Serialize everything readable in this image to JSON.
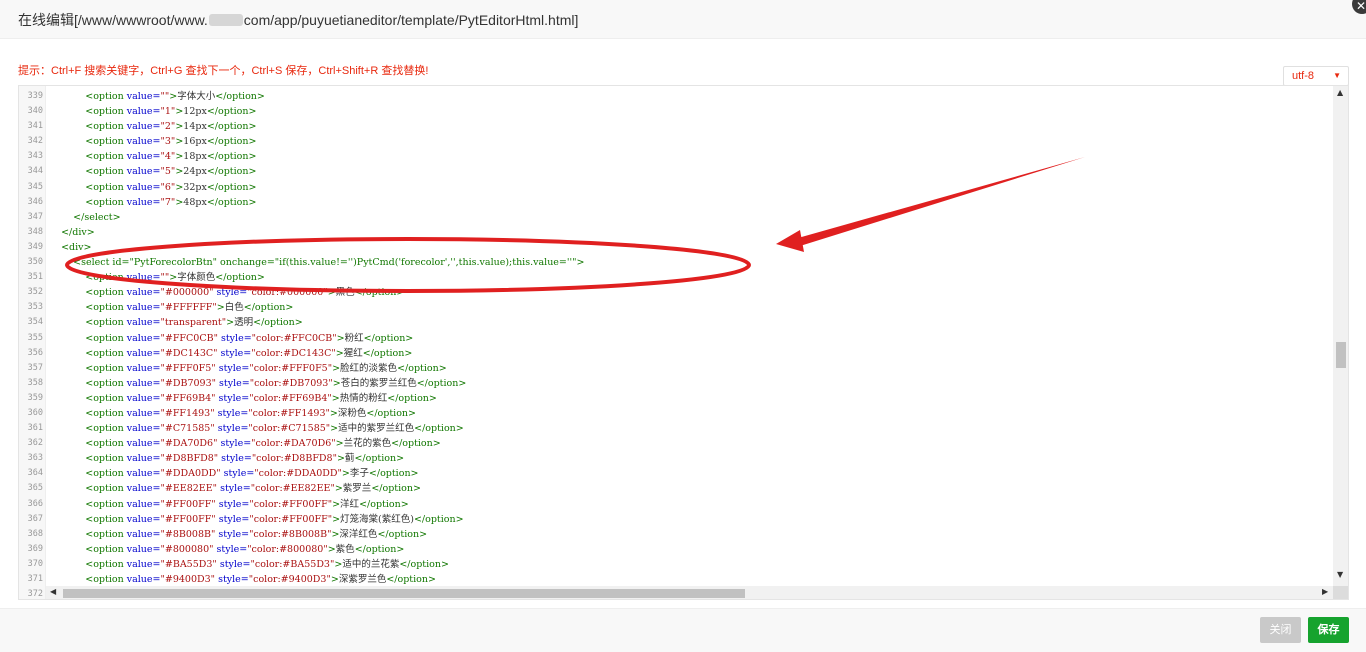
{
  "window": {
    "title_prefix": "在线编辑[/www/wwwroot/www.",
    "title_suffix": "com/app/puyuetianeditor/template/PytEditorHtml.html]",
    "close_glyph": "✕"
  },
  "hint": "提示：Ctrl+F 搜索关键字，Ctrl+G 查找下一个，Ctrl+S 保存，Ctrl+Shift+R 查找替换!",
  "encoding": {
    "value": "utf-8",
    "caret": "▼"
  },
  "editor": {
    "lines": [
      {
        "n": "339",
        "indent": "            ",
        "value": "",
        "style": "",
        "text": "字体大小"
      },
      {
        "n": "340",
        "indent": "            ",
        "value": "1",
        "style": "",
        "text": "12px"
      },
      {
        "n": "341",
        "indent": "            ",
        "value": "2",
        "style": "",
        "text": "14px"
      },
      {
        "n": "342",
        "indent": "            ",
        "value": "3",
        "style": "",
        "text": "16px"
      },
      {
        "n": "343",
        "indent": "            ",
        "value": "4",
        "style": "",
        "text": "18px"
      },
      {
        "n": "344",
        "indent": "            ",
        "value": "5",
        "style": "",
        "text": "24px"
      },
      {
        "n": "345",
        "indent": "            ",
        "value": "6",
        "style": "",
        "text": "32px"
      },
      {
        "n": "346",
        "indent": "            ",
        "value": "7",
        "style": "",
        "text": "48px"
      },
      {
        "n": "347",
        "raw": "        </select>"
      },
      {
        "n": "348",
        "raw": "    </div>"
      },
      {
        "n": "349",
        "raw": "    <div>"
      },
      {
        "n": "350",
        "raw": "        <select id=\"PytForecolorBtn\" onchange=\"if(this.value!='')PytCmd('forecolor','',this.value);this.value=''\">"
      },
      {
        "n": "351",
        "indent": "            ",
        "value": "",
        "style": "",
        "text": "字体颜色"
      },
      {
        "n": "352",
        "indent": "            ",
        "value": "#000000",
        "style": "color:#000000",
        "text": "黑色"
      },
      {
        "n": "353",
        "indent": "            ",
        "value": "#FFFFFF",
        "style": "",
        "text": "白色"
      },
      {
        "n": "354",
        "indent": "            ",
        "value": "transparent",
        "style": "",
        "text": "透明"
      },
      {
        "n": "355",
        "indent": "            ",
        "value": "#FFC0CB",
        "style": "color:#FFC0CB",
        "text": "粉红"
      },
      {
        "n": "356",
        "indent": "            ",
        "value": "#DC143C",
        "style": "color:#DC143C",
        "text": "猩红"
      },
      {
        "n": "357",
        "indent": "            ",
        "value": "#FFF0F5",
        "style": "color:#FFF0F5",
        "text": "脸红的淡紫色"
      },
      {
        "n": "358",
        "indent": "            ",
        "value": "#DB7093",
        "style": "color:#DB7093",
        "text": "苍白的紫罗兰红色"
      },
      {
        "n": "359",
        "indent": "            ",
        "value": "#FF69B4",
        "style": "color:#FF69B4",
        "text": "热情的粉红"
      },
      {
        "n": "360",
        "indent": "            ",
        "value": "#FF1493",
        "style": "color:#FF1493",
        "text": "深粉色"
      },
      {
        "n": "361",
        "indent": "            ",
        "value": "#C71585",
        "style": "color:#C71585",
        "text": "适中的紫罗兰红色"
      },
      {
        "n": "362",
        "indent": "            ",
        "value": "#DA70D6",
        "style": "color:#DA70D6",
        "text": "兰花的紫色"
      },
      {
        "n": "363",
        "indent": "            ",
        "value": "#D8BFD8",
        "style": "color:#D8BFD8",
        "text": "蓟"
      },
      {
        "n": "364",
        "indent": "            ",
        "value": "#DDA0DD",
        "style": "color:#DDA0DD",
        "text": "李子"
      },
      {
        "n": "365",
        "indent": "            ",
        "value": "#EE82EE",
        "style": "color:#EE82EE",
        "text": "紫罗兰"
      },
      {
        "n": "366",
        "indent": "            ",
        "value": "#FF00FF",
        "style": "color:#FF00FF",
        "text": "洋红"
      },
      {
        "n": "367",
        "indent": "            ",
        "value": "#FF00FF",
        "style": "color:#FF00FF",
        "text": "灯笼海棠(紫红色)"
      },
      {
        "n": "368",
        "indent": "            ",
        "value": "#8B008B",
        "style": "color:#8B008B",
        "text": "深洋红色"
      },
      {
        "n": "369",
        "indent": "            ",
        "value": "#800080",
        "style": "color:#800080",
        "text": "紫色"
      },
      {
        "n": "370",
        "indent": "            ",
        "value": "#BA55D3",
        "style": "color:#BA55D3",
        "text": "适中的兰花紫"
      },
      {
        "n": "371",
        "indent": "            ",
        "value": "#9400D3",
        "style": "color:#9400D3",
        "text": "深紫罗兰色"
      },
      {
        "n": "372",
        "indent": "",
        "value": null,
        "style": "",
        "text": ""
      }
    ],
    "scroll": {
      "up": "▲",
      "down": "▼",
      "left": "◀",
      "right": "▶"
    }
  },
  "annotation": {
    "color": "#e02020"
  },
  "footer": {
    "close_label": "关闭",
    "save_label": "保存"
  },
  "colors": {
    "hint": "#e8280e",
    "save": "#16a32e",
    "disabled": "#c9c9c9"
  }
}
